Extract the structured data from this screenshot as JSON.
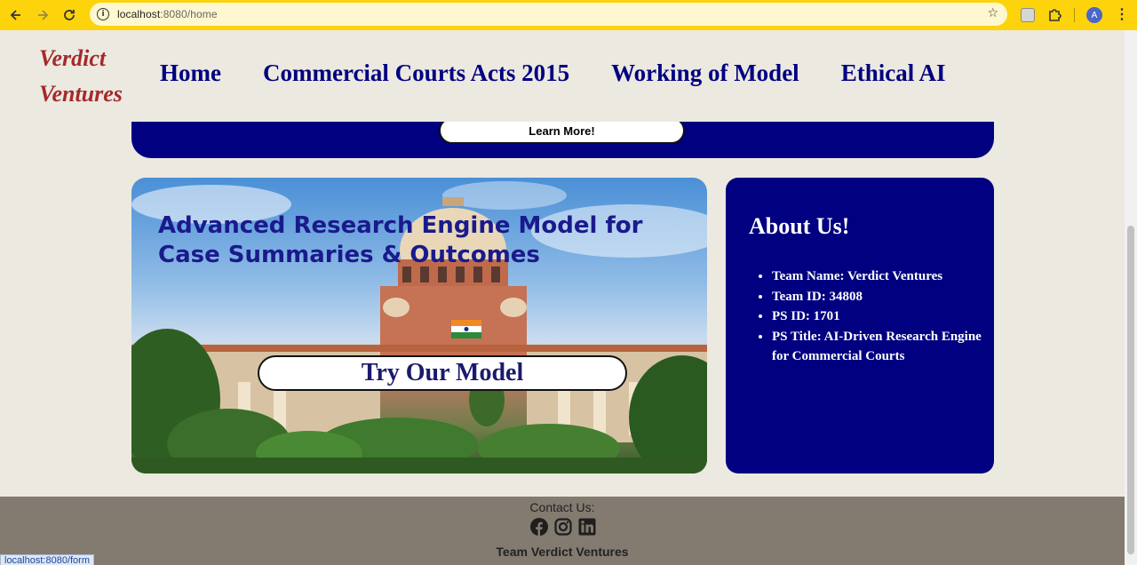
{
  "browser": {
    "url_host": "localhost",
    "url_path": ":8080/home",
    "avatar_letter": "A",
    "status_url": "localhost:8080/form"
  },
  "header": {
    "logo_line1": "Verdict",
    "logo_line2": "Ventures",
    "nav": [
      {
        "label": "Home"
      },
      {
        "label": "Commercial Courts Acts 2015"
      },
      {
        "label": "Working of Model"
      },
      {
        "label": "Ethical AI"
      }
    ]
  },
  "banner": {
    "learn_more_label": "Learn More!"
  },
  "hero": {
    "title": "Advanced Research Engine Model for Case Summaries & Outcomes",
    "cta_label": "Try Our Model"
  },
  "about": {
    "heading": "About Us!",
    "items": [
      "Team Name: Verdict Ventures",
      "Team ID: 34808",
      "PS ID: 1701",
      "PS Title: AI-Driven Research Engine for Commercial Courts"
    ]
  },
  "footer": {
    "contact_label": "Contact Us:",
    "team_label": "Team Verdict Ventures",
    "icons": [
      "facebook-icon",
      "instagram-icon",
      "linkedin-icon"
    ]
  },
  "colors": {
    "chrome": "#fdd30c",
    "navy": "#000080",
    "logo": "#a52a2a",
    "page_bg": "#ece9e1",
    "footer_bg": "#837a70"
  }
}
